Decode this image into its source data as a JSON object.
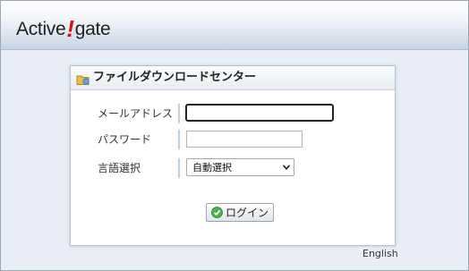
{
  "header": {
    "logo_left": "Active",
    "logo_bang": "!",
    "logo_right": "gate"
  },
  "panel": {
    "title": "ファイルダウンロードセンター",
    "email_label": "メールアドレス",
    "email_value": "",
    "password_label": "パスワード",
    "password_value": "",
    "language_label": "言語選択",
    "language_selected": "自動選択",
    "login_label": "ログイン"
  },
  "footer": {
    "language_link": "English"
  },
  "icons": {
    "title": "folder-icon",
    "login": "check-circle-icon",
    "dropdown": "chevron-down-icon"
  },
  "colors": {
    "logo_accent": "#d0101c",
    "login_icon": "#4caf50"
  }
}
